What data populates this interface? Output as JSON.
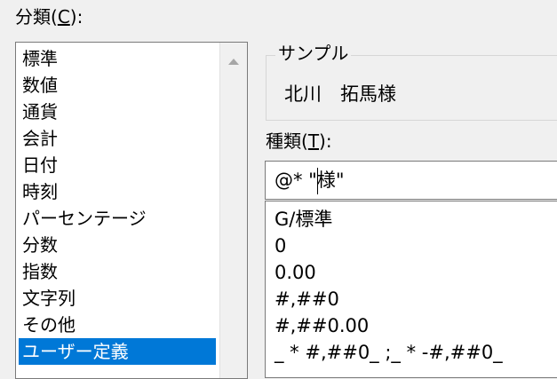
{
  "category_label": {
    "prefix": "分類(",
    "key": "C",
    "suffix": "):"
  },
  "categories": [
    {
      "label": "標準",
      "selected": false
    },
    {
      "label": "数値",
      "selected": false
    },
    {
      "label": "通貨",
      "selected": false
    },
    {
      "label": "会計",
      "selected": false
    },
    {
      "label": "日付",
      "selected": false
    },
    {
      "label": "時刻",
      "selected": false
    },
    {
      "label": "パーセンテージ",
      "selected": false
    },
    {
      "label": "分数",
      "selected": false
    },
    {
      "label": "指数",
      "selected": false
    },
    {
      "label": "文字列",
      "selected": false
    },
    {
      "label": "その他",
      "selected": false
    },
    {
      "label": "ユーザー定義",
      "selected": true
    }
  ],
  "sample": {
    "legend": "サンプル",
    "value": "北川　拓馬様"
  },
  "type_label": {
    "prefix": "種類(",
    "key": "T",
    "suffix": "):"
  },
  "format_input": {
    "value": "@* \"様\""
  },
  "formats": [
    "G/標準",
    "0",
    "0.00",
    "#,##0",
    "#,##0.00",
    "_ * #,##0_ ;_ * -#,##0_"
  ],
  "colors": {
    "selection": "#0078d7",
    "dialog_bg": "#f0f0f0"
  }
}
